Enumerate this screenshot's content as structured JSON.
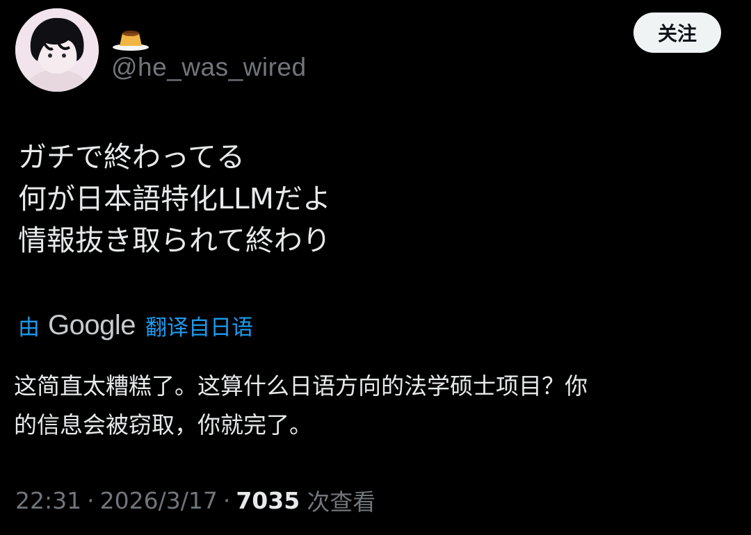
{
  "author": {
    "display_name_icon": "pudding-icon",
    "handle": "@he_was_wired",
    "avatar_icon": "avatar-icon"
  },
  "follow_button": {
    "label": "关注"
  },
  "tweet": {
    "lines": [
      "ガチで終わってる",
      "何が日本語特化LLMだよ",
      "情報抜き取られて終わり"
    ]
  },
  "translation": {
    "prefix": "由",
    "provider": "Google",
    "link_label": "翻译自日语",
    "lines": [
      "这简直太糟糕了。这算什么日语方向的法学硕士项目？你",
      "的信息会被窃取，你就完了。"
    ]
  },
  "meta": {
    "time": "22:31",
    "separator": "·",
    "date": "2026/3/17",
    "views": "7035",
    "views_label": "次查看"
  },
  "colors": {
    "background": "#000000",
    "text": "#e7e9ea",
    "secondary_text": "#71767b",
    "link": "#1d9bf0",
    "follow_button_bg": "#eff3f4"
  }
}
